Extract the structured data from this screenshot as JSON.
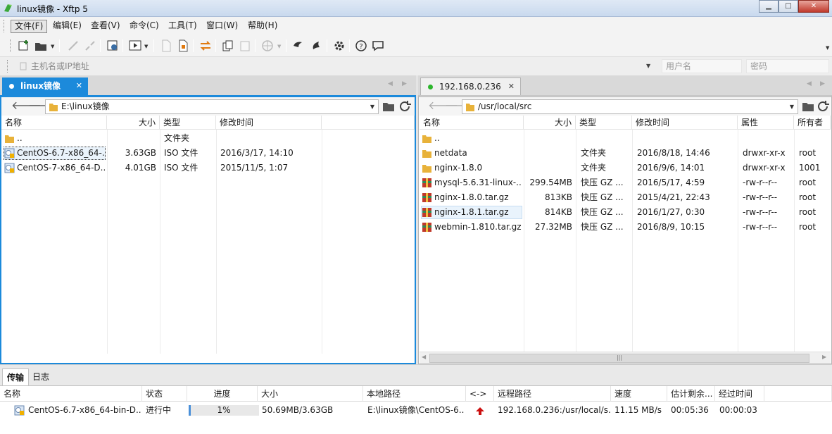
{
  "window": {
    "title": "linux镜像 - Xftp 5",
    "min": "▁",
    "max": "□",
    "close": "✕"
  },
  "menu": [
    "文件(F)",
    "编辑(E)",
    "查看(V)",
    "命令(C)",
    "工具(T)",
    "窗口(W)",
    "帮助(H)"
  ],
  "address": {
    "host_placeholder": "主机名或IP地址",
    "user_placeholder": "用户名",
    "password_placeholder": "密码"
  },
  "left": {
    "tab_label": "linux镜像",
    "path": "E:\\linux镜像",
    "columns": [
      "名称",
      "大小",
      "类型",
      "修改时间"
    ],
    "files": [
      {
        "name": "..",
        "size": "",
        "type": "文件夹",
        "modified": "",
        "kind": "up"
      },
      {
        "name": "CentOS-6.7-x86_64-...",
        "size": "3.63GB",
        "type": "ISO 文件",
        "modified": "2016/3/17, 14:10",
        "kind": "iso"
      },
      {
        "name": "CentOS-7-x86_64-D...",
        "size": "4.01GB",
        "type": "ISO 文件",
        "modified": "2015/11/5, 1:07",
        "kind": "iso"
      }
    ]
  },
  "right": {
    "tab_label": "192.168.0.236",
    "path": "/usr/local/src",
    "columns": [
      "名称",
      "大小",
      "类型",
      "修改时间",
      "属性",
      "所有者"
    ],
    "files": [
      {
        "name": "..",
        "size": "",
        "type": "",
        "modified": "",
        "attr": "",
        "owner": "",
        "kind": "up"
      },
      {
        "name": "netdata",
        "size": "",
        "type": "文件夹",
        "modified": "2016/8/18, 14:46",
        "attr": "drwxr-xr-x",
        "owner": "root",
        "kind": "folder"
      },
      {
        "name": "nginx-1.8.0",
        "size": "",
        "type": "文件夹",
        "modified": "2016/9/6, 14:01",
        "attr": "drwxr-xr-x",
        "owner": "1001",
        "kind": "folder"
      },
      {
        "name": "mysql-5.6.31-linux-...",
        "size": "299.54MB",
        "type": "快压 GZ ...",
        "modified": "2016/5/17, 4:59",
        "attr": "-rw-r--r--",
        "owner": "root",
        "kind": "gz"
      },
      {
        "name": "nginx-1.8.0.tar.gz",
        "size": "813KB",
        "type": "快压 GZ ...",
        "modified": "2015/4/21, 22:43",
        "attr": "-rw-r--r--",
        "owner": "root",
        "kind": "gz"
      },
      {
        "name": "nginx-1.8.1.tar.gz",
        "size": "814KB",
        "type": "快压 GZ ...",
        "modified": "2016/1/27, 0:30",
        "attr": "-rw-r--r--",
        "owner": "root",
        "kind": "gz"
      },
      {
        "name": "webmin-1.810.tar.gz",
        "size": "27.32MB",
        "type": "快压 GZ ...",
        "modified": "2016/8/9, 10:15",
        "attr": "-rw-r--r--",
        "owner": "root",
        "kind": "gz"
      }
    ]
  },
  "bottom": {
    "tabs": [
      "传输",
      "日志"
    ],
    "columns": [
      "名称",
      "状态",
      "进度",
      "大小",
      "本地路径",
      "<->",
      "远程路径",
      "速度",
      "估计剩余...",
      "经过时间"
    ],
    "transfer": {
      "name": "CentOS-6.7-x86_64-bin-D...",
      "status": "进行中",
      "progress": "1%",
      "progress_value": 0.01,
      "size": "50.69MB/3.63GB",
      "local_path": "E:\\linux镜像\\CentOS-6...",
      "remote_path": "192.168.0.236:/usr/local/s...",
      "speed": "11.15 MB/s",
      "eta": "00:05:36",
      "elapsed": "00:00:03"
    }
  },
  "colors": {
    "accent": "#1c8adb",
    "connected": "#2bb52b",
    "upload_arrow": "#cc1010"
  }
}
